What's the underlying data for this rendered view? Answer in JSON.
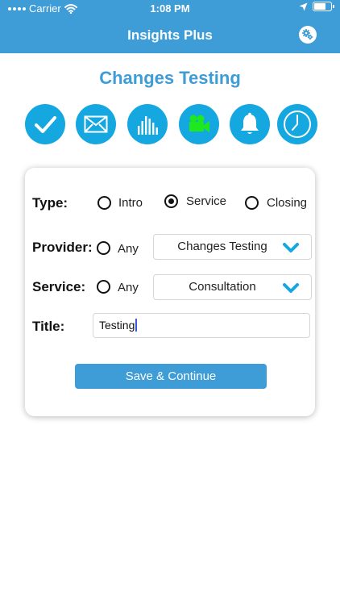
{
  "status_bar": {
    "carrier": "Carrier",
    "time": "1:08 PM"
  },
  "header": {
    "title": "Insights Plus",
    "settings_icon": "gear-icon",
    "background_color": "#3e9cd6"
  },
  "page_title": "Changes Testing",
  "icon_bar": [
    {
      "icon": "checkmark-icon"
    },
    {
      "icon": "envelope-icon"
    },
    {
      "icon": "bar-chart-icon"
    },
    {
      "icon": "video-camera-icon",
      "color": "#1ee81e"
    },
    {
      "icon": "bell-icon"
    },
    {
      "icon": "clock-icon"
    }
  ],
  "form": {
    "type": {
      "label": "Type:",
      "options": [
        "Intro",
        "Service",
        "Closing"
      ],
      "selected": "Service"
    },
    "provider": {
      "label": "Provider:",
      "any_label": "Any",
      "value": "Changes Testing"
    },
    "service": {
      "label": "Service:",
      "any_label": "Any",
      "value": "Consultation"
    },
    "title": {
      "label": "Title:",
      "value": "Testing"
    },
    "save_label": "Save & Continue"
  },
  "colors": {
    "accent": "#3e9cd6",
    "icon_circle": "#15a8e0",
    "chevron": "#15a8e0"
  }
}
